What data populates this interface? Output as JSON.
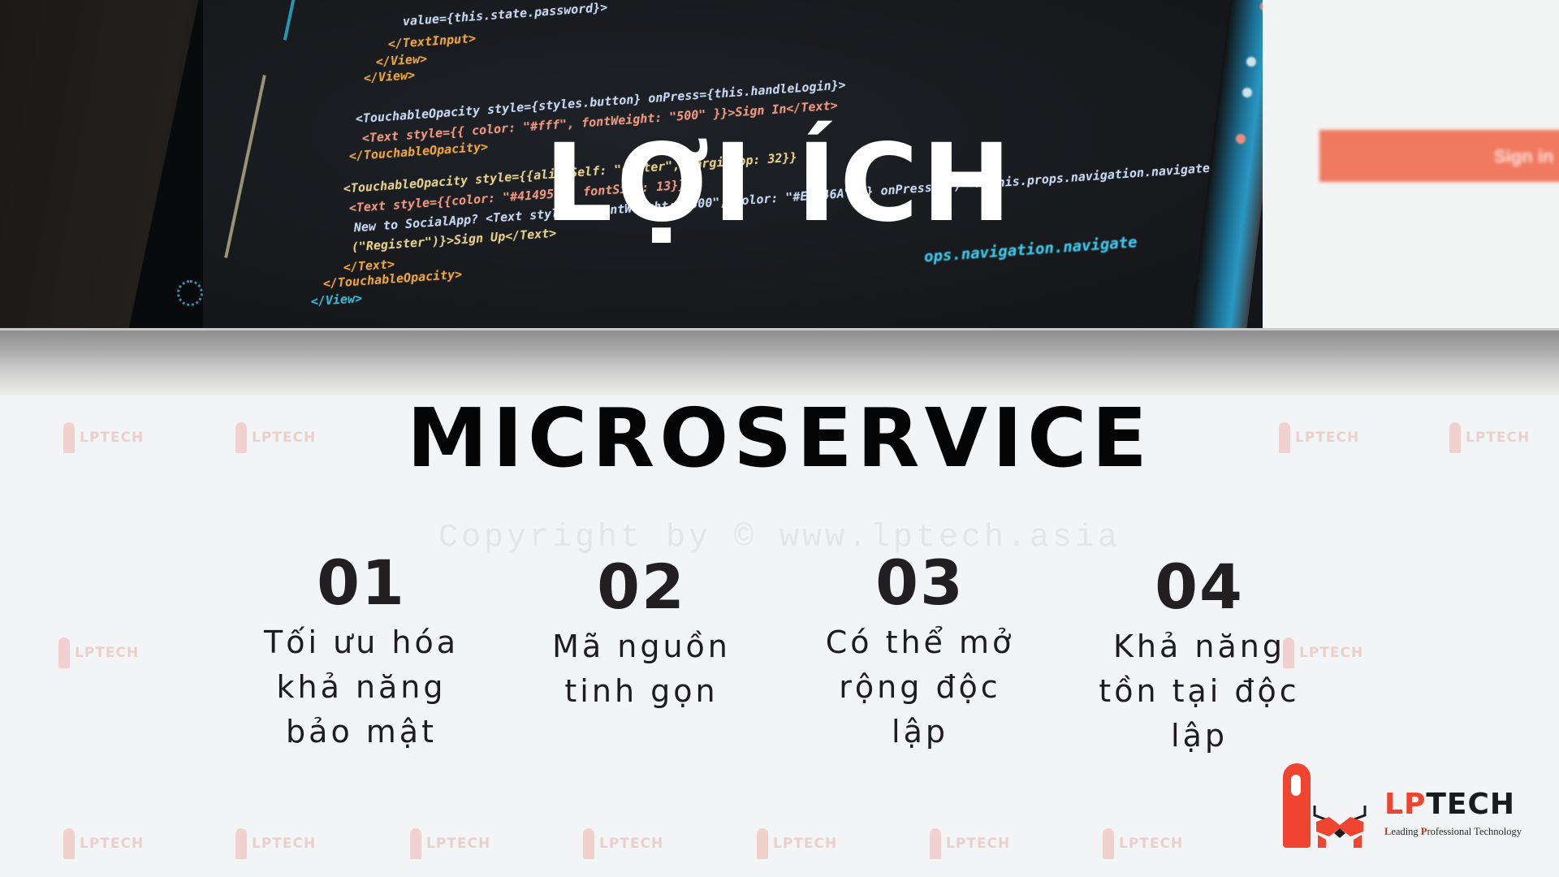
{
  "hero": {
    "title": "LỢI ÍCH",
    "background_code_lines": [
      "value={this.state.password}>",
      "</TextInput>",
      "</View>",
      "</View>",
      "<TouchableOpacity style={styles.button} onPress={this.handleLogin}>",
      "<Text style={{ color: \"#fff\", fontWeight: \"500\" }}>Sign In</Text>",
      "</TouchableOpacity>",
      "<TouchableOpacity style={{alignSelf: \"center\", marginTop: 32}}",
      "<Text style={{color: \"#414959\", fontSize: 13}}>",
      "New to SocialApp? <Text style={{ fontWeight: \"500\", color: \"#E9446A\" }} onPress={() => this.props.navigation.navigate",
      "(\"Register\")}>Sign Up</Text>",
      "</Text>",
      "</TouchableOpacity>",
      "</View>"
    ],
    "navigate_fragment": "ops.navigation.navigate",
    "phone_button_label": "Sign in"
  },
  "main_title": "MICROSERVICE",
  "watermark": {
    "brand": "LPTECH",
    "copyright": "Copyright by © www.lptech.asia"
  },
  "benefits": [
    {
      "number": "01",
      "lines": [
        "Tối ưu hóa",
        "khả năng",
        "bảo mật"
      ]
    },
    {
      "number": "02",
      "lines": [
        "Mã nguồn",
        "tinh gọn"
      ]
    },
    {
      "number": "03",
      "lines": [
        "Có thể mở",
        "rộng độc",
        "lập"
      ]
    },
    {
      "number": "04",
      "lines": [
        "Khả năng",
        "tồn tại độc",
        "lập"
      ]
    }
  ],
  "logo": {
    "wordmark_a": "LP",
    "wordmark_b": "TECH",
    "tagline_parts": [
      "L",
      "eading ",
      "P",
      "rofessional Technology"
    ],
    "brand_color": "#ee4430"
  }
}
